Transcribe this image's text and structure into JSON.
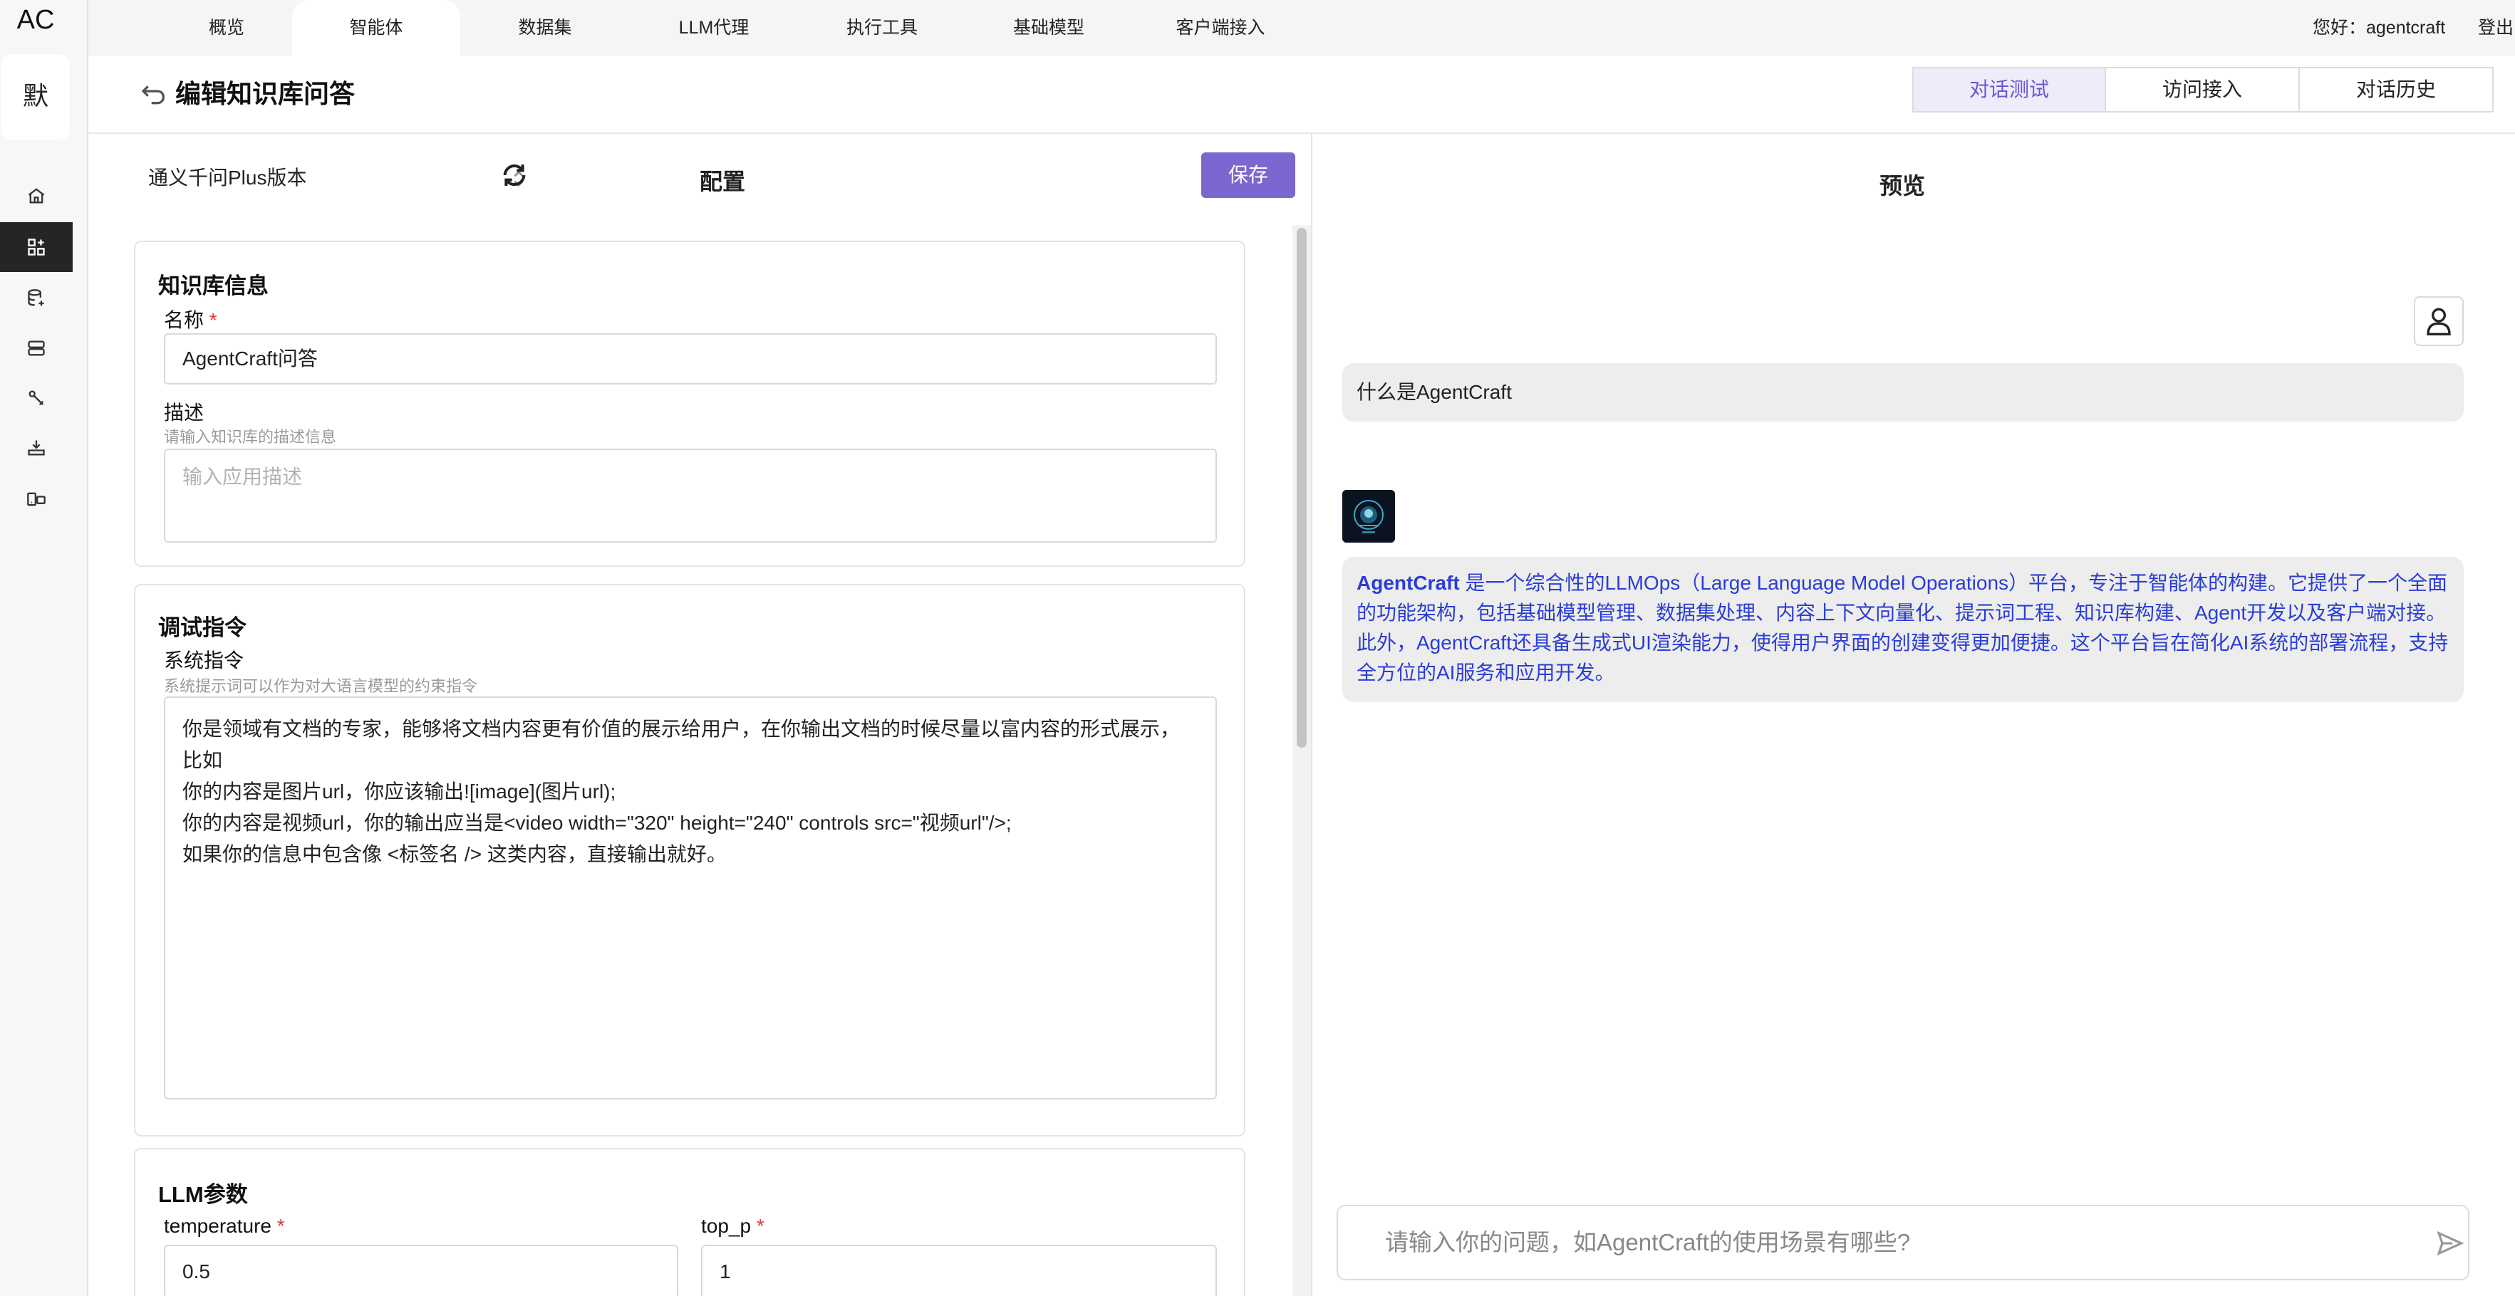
{
  "app": {
    "logo": "AC",
    "avatar_char": "默"
  },
  "topnav": {
    "tabs": [
      "概览",
      "智能体",
      "数据集",
      "LLM代理",
      "执行工具",
      "基础模型",
      "客户端接入"
    ],
    "active_tab": "智能体",
    "greeting": "您好：agentcraft",
    "logout": "登出"
  },
  "sidebar": {
    "icons": [
      "home-icon",
      "apps-icon",
      "database-add-icon",
      "storage-icon",
      "tool-icon",
      "model-icon",
      "client-icon"
    ],
    "active_index": 1
  },
  "header": {
    "title": "编辑知识库问答",
    "tabs": [
      "对话测试",
      "访问接入",
      "对话历史"
    ],
    "active_tab": "对话测试"
  },
  "config": {
    "model_select": "通义千问Plus版本",
    "title": "配置",
    "save_label": "保存",
    "kb_info": {
      "title": "知识库信息",
      "name_label": "名称",
      "name_value": "AgentCraft问答",
      "desc_label": "描述",
      "desc_hint": "请输入知识库的描述信息",
      "desc_placeholder": "输入应用描述"
    },
    "debug": {
      "title": "调试指令",
      "sys_label": "系统指令",
      "sys_hint": "系统提示词可以作为对大语言模型的约束指令",
      "sys_prompt": "你是领域有文档的专家，能够将文档内容更有价值的展示给用户，在你输出文档的时候尽量以富内容的形式展示，\n比如\n你的内容是图片url，你应该输出![image](图片url);\n你的内容是视频url，你的输出应当是<video width=\"320\" height=\"240\" controls src=\"视频url\"/>;\n如果你的信息中包含像 <标签名 /> 这类内容，直接输出就好。"
    },
    "llm": {
      "title": "LLM参数",
      "temperature_label": "temperature",
      "temperature_value": "0.5",
      "top_p_label": "top_p",
      "top_p_value": "1"
    }
  },
  "preview": {
    "title": "预览",
    "user_message": "什么是AgentCraft",
    "bot_brand": "AgentCraft",
    "bot_message_rest": " 是一个综合性的LLMOps（Large Language Model Operations）平台，专注于智能体的构建。它提供了一个全面的功能架构，包括基础模型管理、数据集处理、内容上下文向量化、提示词工程、知识库构建、Agent开发以及客户端对接。此外，AgentCraft还具备生成式UI渲染能力，使得用户界面的创建变得更加便捷。这个平台旨在简化AI系统的部署流程，支持全方位的AI服务和应用开发。",
    "input_placeholder": "请输入你的问题，如AgentCraft的使用场景有哪些?"
  }
}
